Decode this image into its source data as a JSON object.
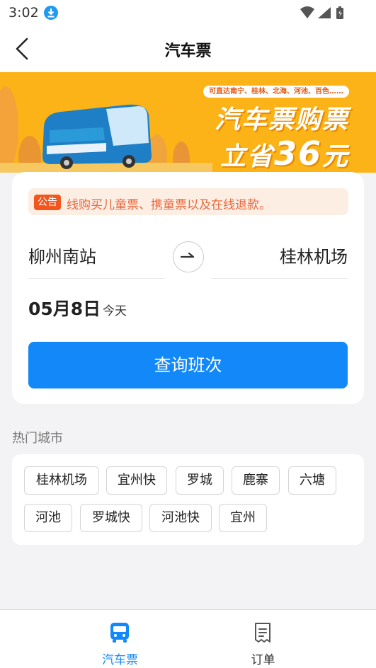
{
  "status_bar": {
    "time": "3:02"
  },
  "nav": {
    "title": "汽车票"
  },
  "banner": {
    "tag": "可直达南宁、桂林、北海、河池、百色……",
    "headline1": "汽车票购票",
    "headline2_prefix": "立省",
    "headline2_number": "36",
    "headline2_suffix": "元"
  },
  "notice": {
    "badge": "公告",
    "text": "线购买儿童票、携童票以及在线退款。"
  },
  "route": {
    "from": "柳州南站",
    "to": "桂林机场"
  },
  "date": {
    "main": "05月8日",
    "sub": "今天"
  },
  "search": {
    "label": "查询班次"
  },
  "hot": {
    "label": "热门城市",
    "chips": [
      "桂林机场",
      "宜州快",
      "罗城",
      "鹿寨",
      "六塘",
      "河池",
      "罗城快",
      "河池快",
      "宜州"
    ]
  },
  "tabs": [
    {
      "label": "汽车票",
      "active": true
    },
    {
      "label": "订单",
      "active": false
    }
  ],
  "colors": {
    "accent": "#1388f8",
    "notice_bg": "#fdeee4",
    "notice_text": "#e9683e",
    "banner_bg": "#fbb317"
  }
}
